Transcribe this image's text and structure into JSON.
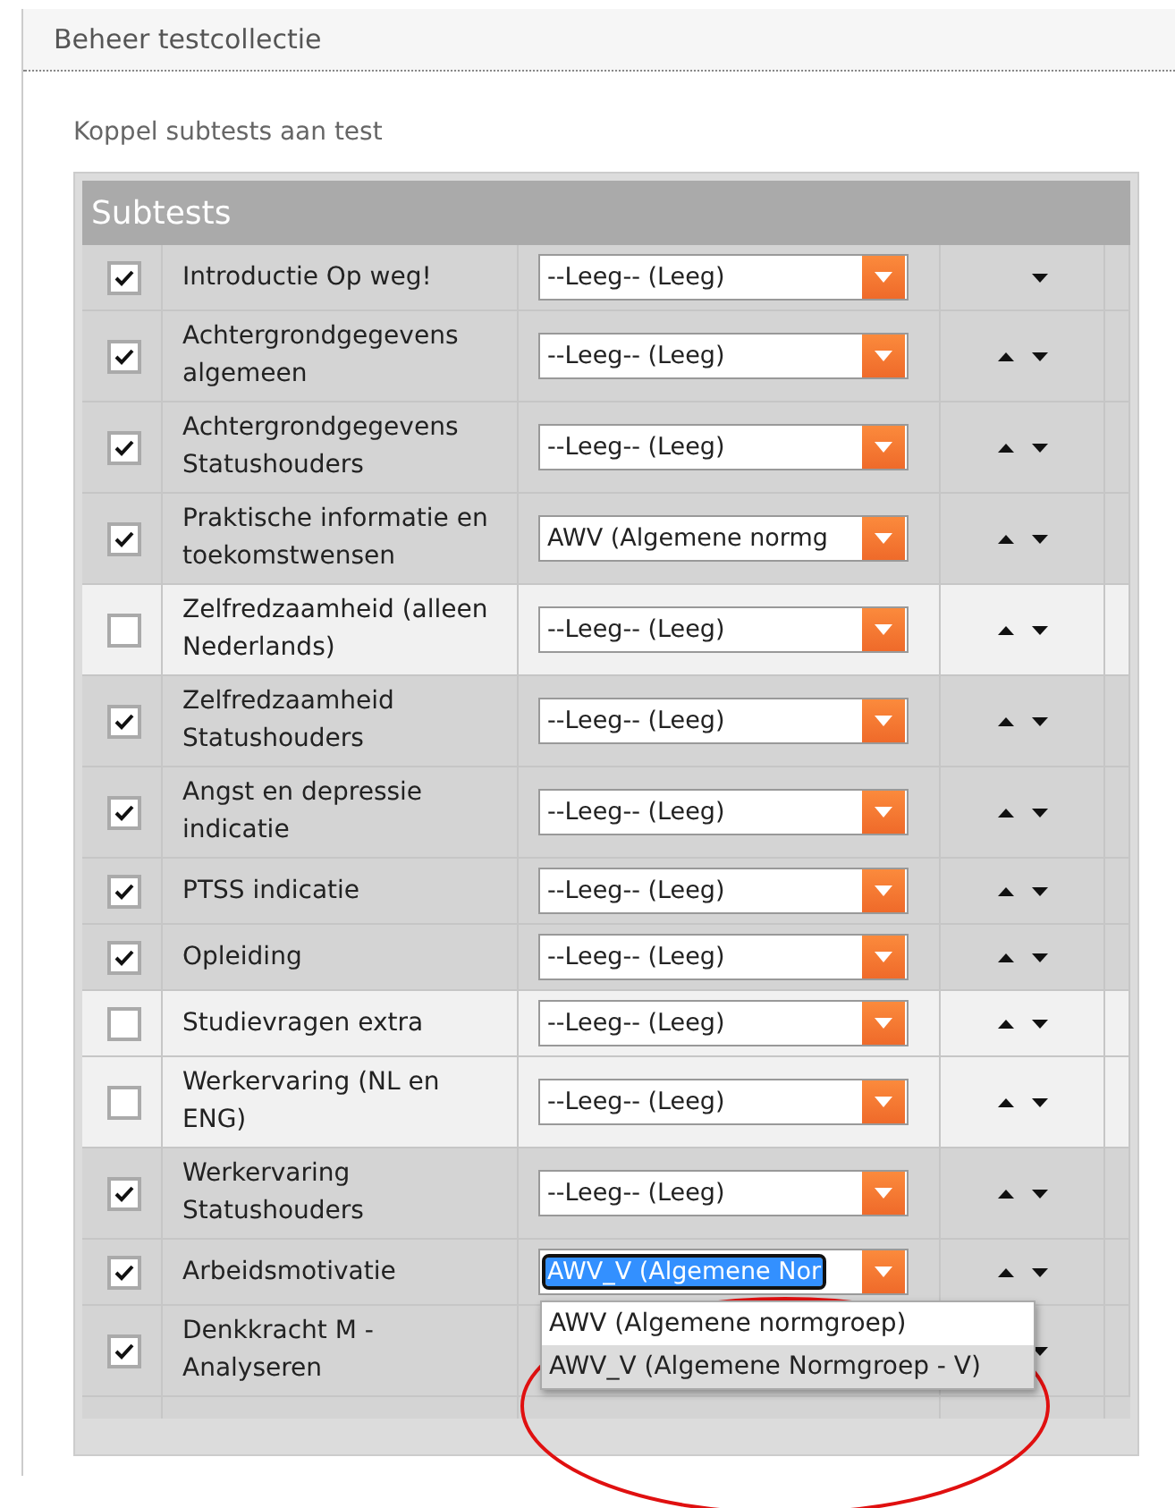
{
  "header": {
    "title": "Beheer testcollectie"
  },
  "section": {
    "title": "Koppel subtests aan test"
  },
  "panel": {
    "title": "Subtests",
    "rows": [
      {
        "name": "Introductie Op weg!",
        "checked": true,
        "value": "--Leeg-- (Leeg)",
        "up": false,
        "down": true
      },
      {
        "name": "Achtergrondgegevens algemeen",
        "checked": true,
        "value": "--Leeg-- (Leeg)",
        "up": true,
        "down": true
      },
      {
        "name": "Achtergrondgegevens Statushouders",
        "checked": true,
        "value": "--Leeg-- (Leeg)",
        "up": true,
        "down": true
      },
      {
        "name": "Praktische informatie en toekomstwensen",
        "checked": true,
        "value": "AWV (Algemene normg",
        "up": true,
        "down": true
      },
      {
        "name": "Zelfredzaamheid (alleen Nederlands)",
        "checked": false,
        "value": "--Leeg-- (Leeg)",
        "up": true,
        "down": true
      },
      {
        "name": "Zelfredzaamheid Statushouders",
        "checked": true,
        "value": "--Leeg-- (Leeg)",
        "up": true,
        "down": true
      },
      {
        "name": "Angst en depressie indicatie",
        "checked": true,
        "value": "--Leeg-- (Leeg)",
        "up": true,
        "down": true
      },
      {
        "name": "PTSS indicatie",
        "checked": true,
        "value": "--Leeg-- (Leeg)",
        "up": true,
        "down": true
      },
      {
        "name": "Opleiding",
        "checked": true,
        "value": "--Leeg-- (Leeg)",
        "up": true,
        "down": true
      },
      {
        "name": "Studievragen extra",
        "checked": false,
        "value": "--Leeg-- (Leeg)",
        "up": true,
        "down": true
      },
      {
        "name": "Werkervaring (NL en ENG)",
        "checked": false,
        "value": "--Leeg-- (Leeg)",
        "up": true,
        "down": true
      },
      {
        "name": "Werkervaring Statushouders",
        "checked": true,
        "value": "--Leeg-- (Leeg)",
        "up": true,
        "down": true
      },
      {
        "name": "Arbeidsmotivatie",
        "checked": true,
        "value": "AWV_V (Algemene Nor",
        "up": true,
        "down": true,
        "focused": true,
        "open": true,
        "options": [
          {
            "label": "AWV (Algemene normgroep)",
            "selected": false
          },
          {
            "label": "AWV_V (Algemene Normgroep - V)",
            "selected": true
          }
        ]
      },
      {
        "name": "Denkkracht M - Analyseren",
        "checked": true,
        "up": false,
        "down": true
      }
    ]
  },
  "annotation": {
    "kind": "ellipse",
    "color": "#e01010"
  }
}
